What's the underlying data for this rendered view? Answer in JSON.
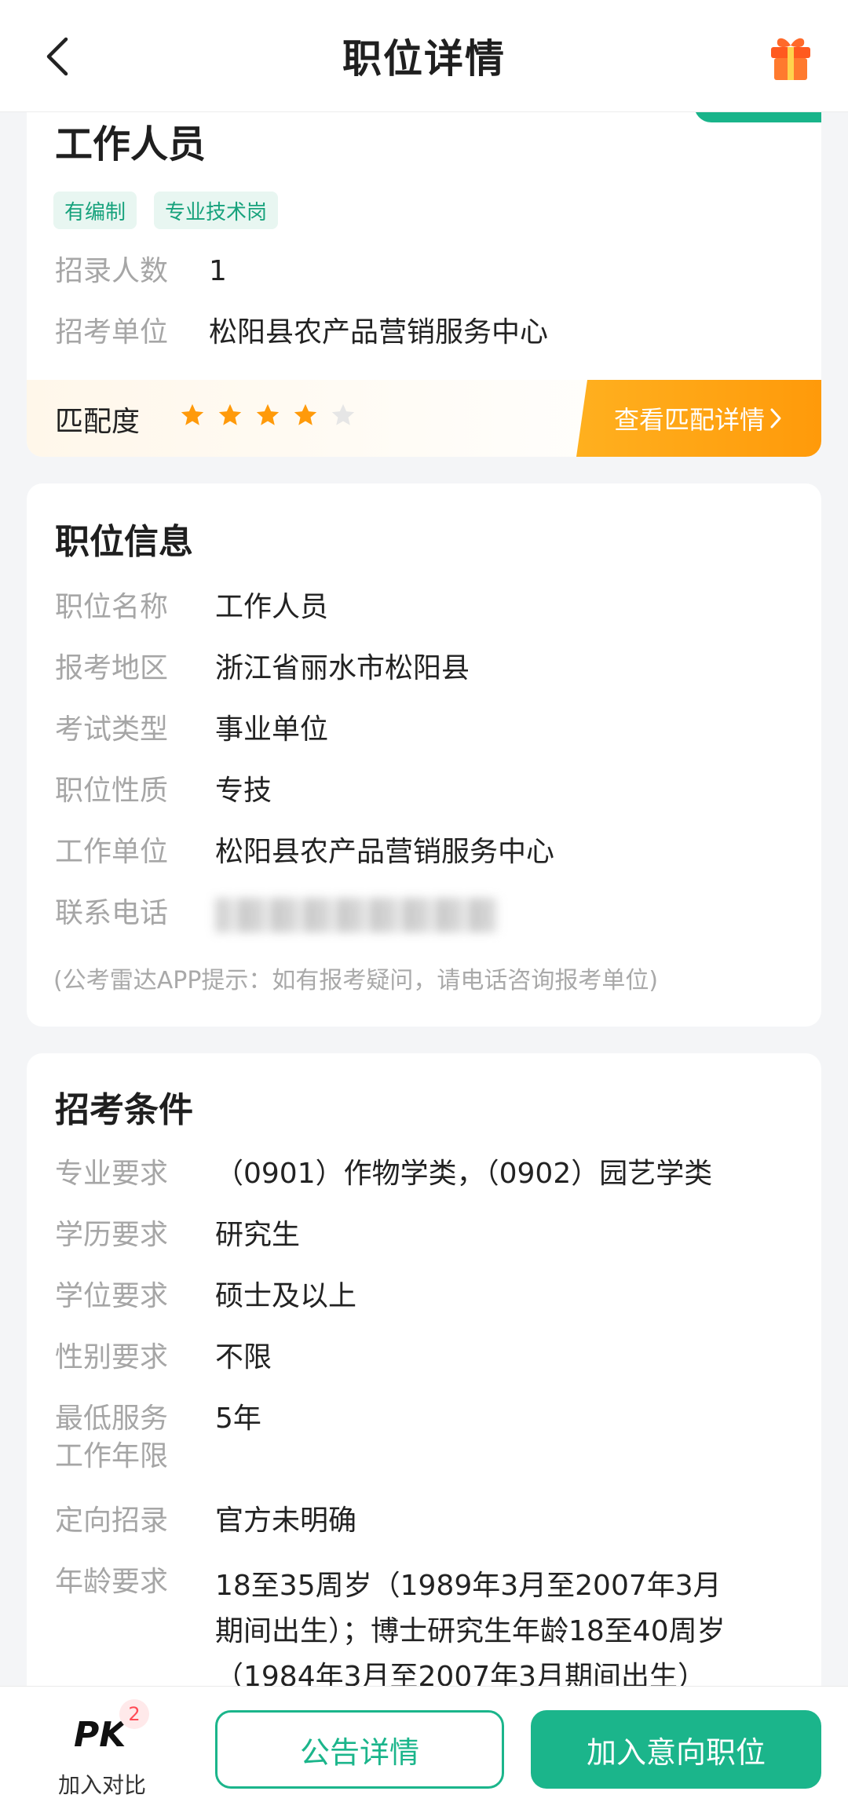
{
  "header": {
    "title": "职位详情"
  },
  "summary": {
    "job_title": "工作人员",
    "chips": [
      "有编制",
      "专业技术岗"
    ],
    "rows": [
      {
        "label": "招录人数",
        "value": "1"
      },
      {
        "label": "招考单位",
        "value": "松阳县农产品营销服务中心"
      }
    ],
    "match": {
      "label": "匹配度",
      "rating": 4,
      "max": 5,
      "button_label": "查看匹配详情"
    }
  },
  "position_info": {
    "title": "职位信息",
    "rows": [
      {
        "label": "职位名称",
        "value": "工作人员"
      },
      {
        "label": "报考地区",
        "value": "浙江省丽水市松阳县"
      },
      {
        "label": "考试类型",
        "value": "事业单位"
      },
      {
        "label": "职位性质",
        "value": "专技"
      },
      {
        "label": "工作单位",
        "value": "松阳县农产品营销服务中心"
      },
      {
        "label": "联系电话",
        "value": ""
      }
    ],
    "note": "(公考雷达APP提示：如有报考疑问，请电话咨询报考单位)"
  },
  "conditions": {
    "title": "招考条件",
    "rows": [
      {
        "label": "专业要求",
        "value": "（0901）作物学类，（0902）园艺学类"
      },
      {
        "label": "学历要求",
        "value": "研究生"
      },
      {
        "label": "学位要求",
        "value": "硕士及以上"
      },
      {
        "label": "性别要求",
        "value": "不限"
      },
      {
        "label": "最低服务",
        "label2": "工作年限",
        "value": "5年"
      },
      {
        "label": "定向招录",
        "value": "官方未明确"
      },
      {
        "label": "年龄要求",
        "value_lines": [
          "18至35周岁（1989年3月至2007年3月",
          "期间出生）；博士研究生年龄18至40周岁",
          "（1984年3月至2007年3月期间出生）"
        ]
      }
    ]
  },
  "bottom_bar": {
    "pk_text": "PK",
    "pk_badge": "2",
    "compare_label": "加入对比",
    "notice_button": "公告详情",
    "add_button": "加入意向职位"
  },
  "colors": {
    "accent": "#1bb58b",
    "orange": "#ff9a0a",
    "star_filled": "#ff9a0a",
    "star_empty": "#e6e6e6"
  }
}
